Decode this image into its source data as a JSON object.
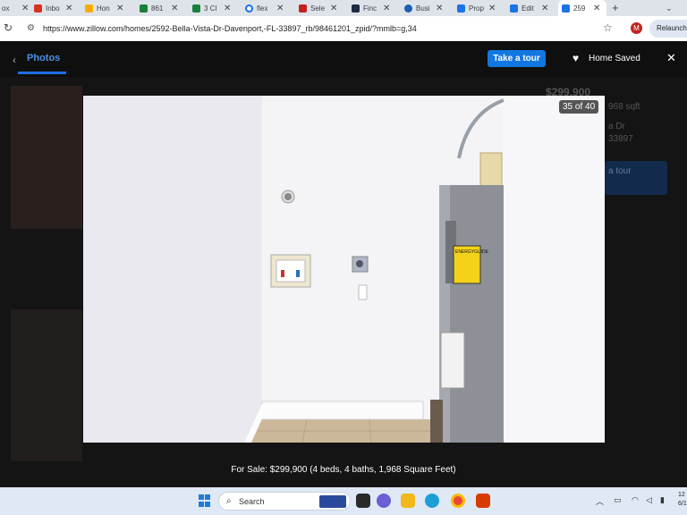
{
  "browser": {
    "tabs": [
      {
        "label": "ox",
        "color": "#888888"
      },
      {
        "label": "Inbo",
        "color": "#d93025"
      },
      {
        "label": "Hon",
        "color": "#1a73e8"
      },
      {
        "label": "861",
        "color": "#188038"
      },
      {
        "label": "3 Cl",
        "color": "#188038"
      },
      {
        "label": "flex",
        "color": "#3c4043"
      },
      {
        "label": "Sele",
        "color": "#c5221f"
      },
      {
        "label": "Finc",
        "color": "#1f2a44"
      },
      {
        "label": "Busi",
        "color": "#1a5fb4"
      },
      {
        "label": "Prop",
        "color": "#1a73e8"
      },
      {
        "label": "Edit",
        "color": "#1a73e8"
      },
      {
        "label": "259",
        "color": "#1a73e8"
      }
    ],
    "url": "https://www.zillow.com/homes/2592-Bella-Vista-Dr-Davenport,-FL-33897_rb/98461201_zpid/?mmlb=g,34",
    "profile_initial": "M",
    "relaunch_label": "Relaunch t"
  },
  "header": {
    "photos_tab": "Photos",
    "take_tour": "Take a tour",
    "home_saved": "Home Saved"
  },
  "background": {
    "price": "$299,900",
    "sqft": "968 sqft",
    "address_fragment": "a Dr",
    "zip_fragment": "33897",
    "tour_label": "a tour"
  },
  "photo": {
    "counter": "35 of 40",
    "label_text": "ENERGYGUIDE"
  },
  "caption": "For Sale: $299,900 (4 beds, 4 baths, 1,968 Square Feet)",
  "taskbar": {
    "search_placeholder": "Search",
    "clock_time": "12",
    "clock_date": "6/1"
  }
}
